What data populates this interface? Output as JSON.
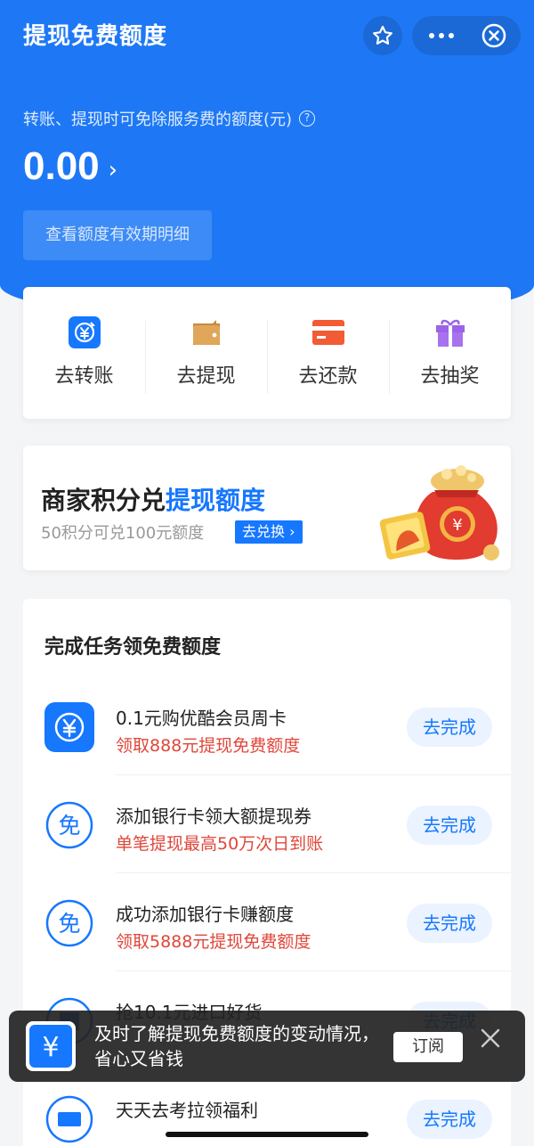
{
  "header": {
    "title": "提现免费额度",
    "favorite_icon": "star-icon",
    "more_icon": "more-dots-icon",
    "close_icon": "close-circle-icon"
  },
  "summary": {
    "description": "转账、提现时可免除服务费的额度(元)",
    "help_icon": "question-icon",
    "amount": "0.00",
    "arrow": "›",
    "detail_button": "查看额度有效期明细"
  },
  "actions": [
    {
      "label": "去转账",
      "icon": "transfer-icon",
      "color": "#1677ff"
    },
    {
      "label": "去提现",
      "icon": "wallet-icon",
      "color": "#d89a4a"
    },
    {
      "label": "去还款",
      "icon": "card-icon",
      "color": "#f25b34"
    },
    {
      "label": "去抽奖",
      "icon": "gift-icon",
      "color": "#9b63e8"
    }
  ],
  "promo": {
    "title_plain": "商家积分兑",
    "title_highlight": "提现额度",
    "subtitle": "50积分可兑100元额度",
    "button": "去兑换 ›"
  },
  "tasks": {
    "title": "完成任务领免费额度",
    "items": [
      {
        "name": "0.1元购优酷会员周卡",
        "desc": "领取888元提现免费额度",
        "button": "去完成",
        "icon": "yen-icon"
      },
      {
        "name": "添加银行卡领大额提现券",
        "desc": "单笔提现最高50万次日到账",
        "button": "去完成",
        "icon": "free-badge-icon",
        "icon_text": "免"
      },
      {
        "name": "成功添加银行卡赚额度",
        "desc": "领取5888元提现免费额度",
        "button": "去完成",
        "icon": "free-badge-icon",
        "icon_text": "免"
      },
      {
        "name": "抢10.1元进口好货",
        "desc": "",
        "button": "去完成",
        "icon": "shop-icon"
      },
      {
        "name": "天天去考拉领福利",
        "desc": "",
        "button": "去完成",
        "icon": "ticket-icon"
      }
    ]
  },
  "toast": {
    "text": "及时了解提现免费额度的变动情况，省心又省钱",
    "button": "订阅",
    "icon": "yen-icon",
    "close_icon": "close-icon"
  },
  "colors": {
    "brand": "#1e78f5",
    "accent": "#1677ff",
    "warning_text": "#e0463a"
  }
}
